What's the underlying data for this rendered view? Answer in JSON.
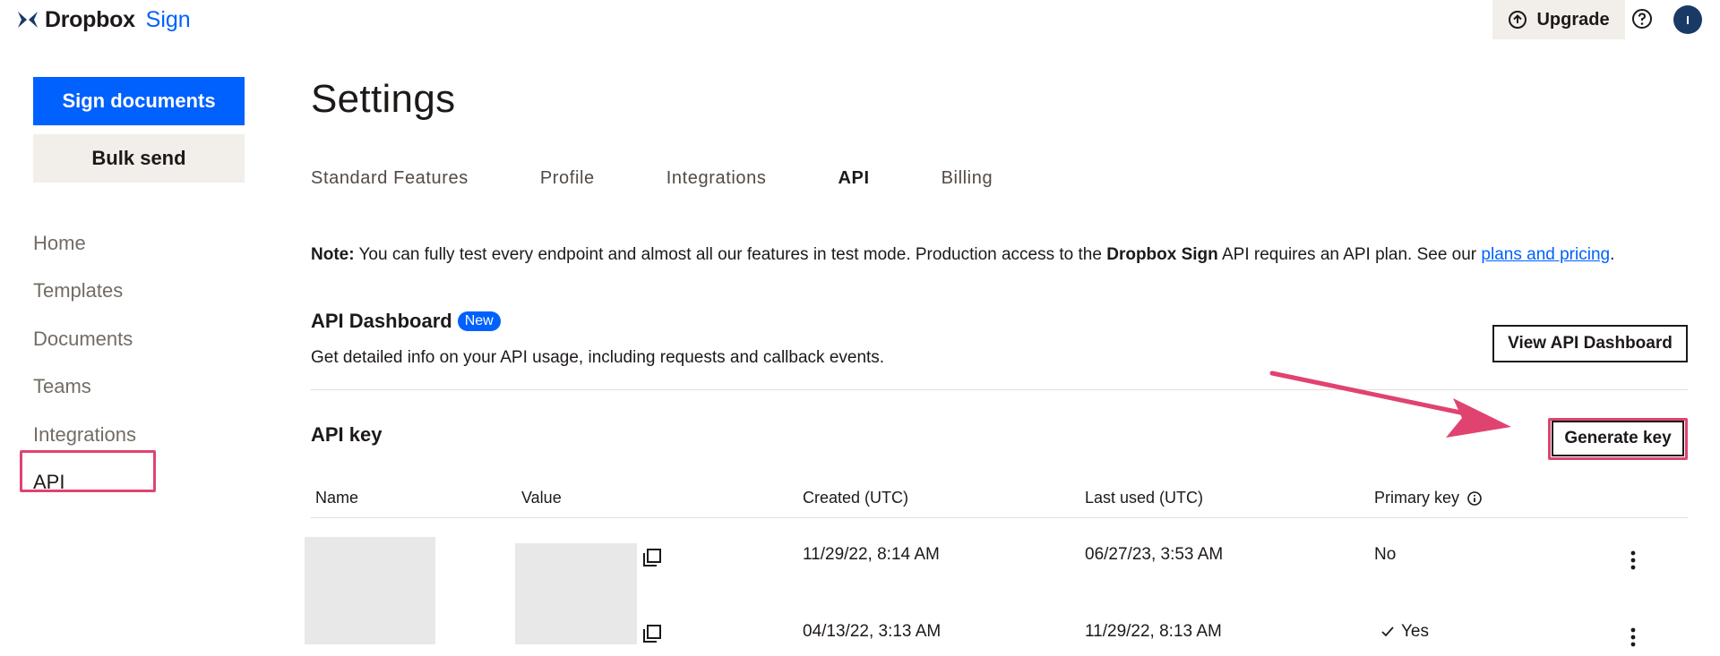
{
  "header": {
    "logo_brand": "Dropbox",
    "logo_product": "Sign",
    "upgrade_label": "Upgrade",
    "avatar_initial": "I"
  },
  "sidebar": {
    "primary_button": "Sign documents",
    "secondary_button": "Bulk send",
    "items": [
      {
        "label": "Home"
      },
      {
        "label": "Templates"
      },
      {
        "label": "Documents"
      },
      {
        "label": "Teams"
      },
      {
        "label": "Integrations"
      },
      {
        "label": "API"
      }
    ]
  },
  "page": {
    "title": "Settings",
    "tabs": [
      {
        "label": "Standard Features"
      },
      {
        "label": "Profile"
      },
      {
        "label": "Integrations"
      },
      {
        "label": "API"
      },
      {
        "label": "Billing"
      }
    ]
  },
  "note": {
    "prefix": "Note:",
    "text1": " You can fully test every endpoint and almost all our features in test mode. Production access to the ",
    "bold": "Dropbox Sign",
    "text2": " API requires an API plan. See our ",
    "link": "plans and pricing",
    "suffix": "."
  },
  "dashboard": {
    "title": "API Dashboard",
    "badge": "New",
    "description": "Get detailed info on your API usage, including requests and callback events.",
    "button": "View API Dashboard"
  },
  "api_key": {
    "title": "API key",
    "generate_button": "Generate key",
    "columns": [
      "Name",
      "Value",
      "Created (UTC)",
      "Last used (UTC)",
      "Primary key"
    ],
    "rows": [
      {
        "created": "11/29/22, 8:14 AM",
        "last_used": "06/27/23, 3:53 AM",
        "primary": "No"
      },
      {
        "created": "04/13/22, 3:13 AM",
        "last_used": "11/29/22, 8:13 AM",
        "primary": "Yes"
      }
    ]
  },
  "colors": {
    "brand_blue": "#0061fe",
    "highlight_pink": "#e0436f",
    "neutral_bg": "#f2efea"
  }
}
